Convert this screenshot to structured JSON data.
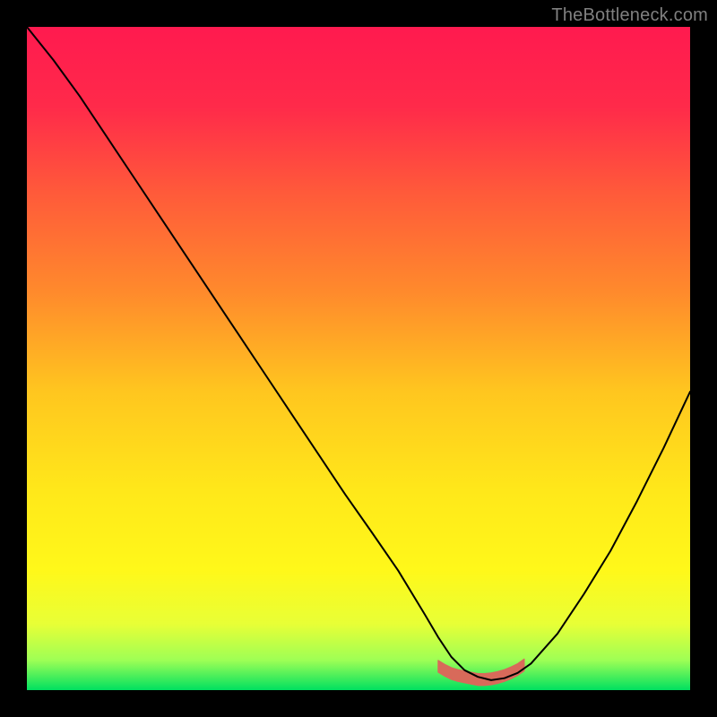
{
  "watermark": "TheBottleneck.com",
  "chart_data": {
    "type": "line",
    "title": "",
    "xlabel": "",
    "ylabel": "",
    "xlim": [
      0,
      100
    ],
    "ylim": [
      0,
      100
    ],
    "background_gradient": {
      "stops": [
        {
          "offset": 0.0,
          "color": "#ff1a4f"
        },
        {
          "offset": 0.12,
          "color": "#ff2a4a"
        },
        {
          "offset": 0.25,
          "color": "#ff5a3a"
        },
        {
          "offset": 0.4,
          "color": "#ff8a2c"
        },
        {
          "offset": 0.55,
          "color": "#ffc61f"
        },
        {
          "offset": 0.7,
          "color": "#ffe81a"
        },
        {
          "offset": 0.82,
          "color": "#fff81a"
        },
        {
          "offset": 0.9,
          "color": "#e8ff36"
        },
        {
          "offset": 0.955,
          "color": "#9eff55"
        },
        {
          "offset": 1.0,
          "color": "#00e060"
        }
      ]
    },
    "series": [
      {
        "name": "bottleneck-curve",
        "color": "#000000",
        "width": 2,
        "x": [
          0,
          4,
          8,
          12,
          16,
          20,
          24,
          28,
          32,
          36,
          40,
          44,
          48,
          52,
          56,
          60,
          62,
          64,
          66,
          68,
          70,
          72,
          74,
          76,
          80,
          84,
          88,
          92,
          96,
          100
        ],
        "y": [
          100,
          95,
          89.5,
          83.5,
          77.5,
          71.5,
          65.5,
          59.5,
          53.5,
          47.5,
          41.5,
          35.5,
          29.5,
          23.8,
          18.0,
          11.4,
          8.0,
          5.0,
          3.0,
          2.0,
          1.5,
          1.8,
          2.6,
          4.0,
          8.5,
          14.5,
          21.0,
          28.5,
          36.5,
          45.0
        ]
      }
    ],
    "valley_marker": {
      "color": "#d86a5a",
      "height_frac": 0.018,
      "x": [
        62,
        63,
        64,
        65,
        66,
        67,
        68,
        69,
        70,
        71,
        72,
        73,
        74,
        75
      ],
      "y": [
        3.6,
        3.0,
        2.5,
        2.2,
        2.0,
        1.8,
        1.6,
        1.6,
        1.7,
        1.9,
        2.2,
        2.6,
        3.1,
        3.8
      ]
    }
  }
}
